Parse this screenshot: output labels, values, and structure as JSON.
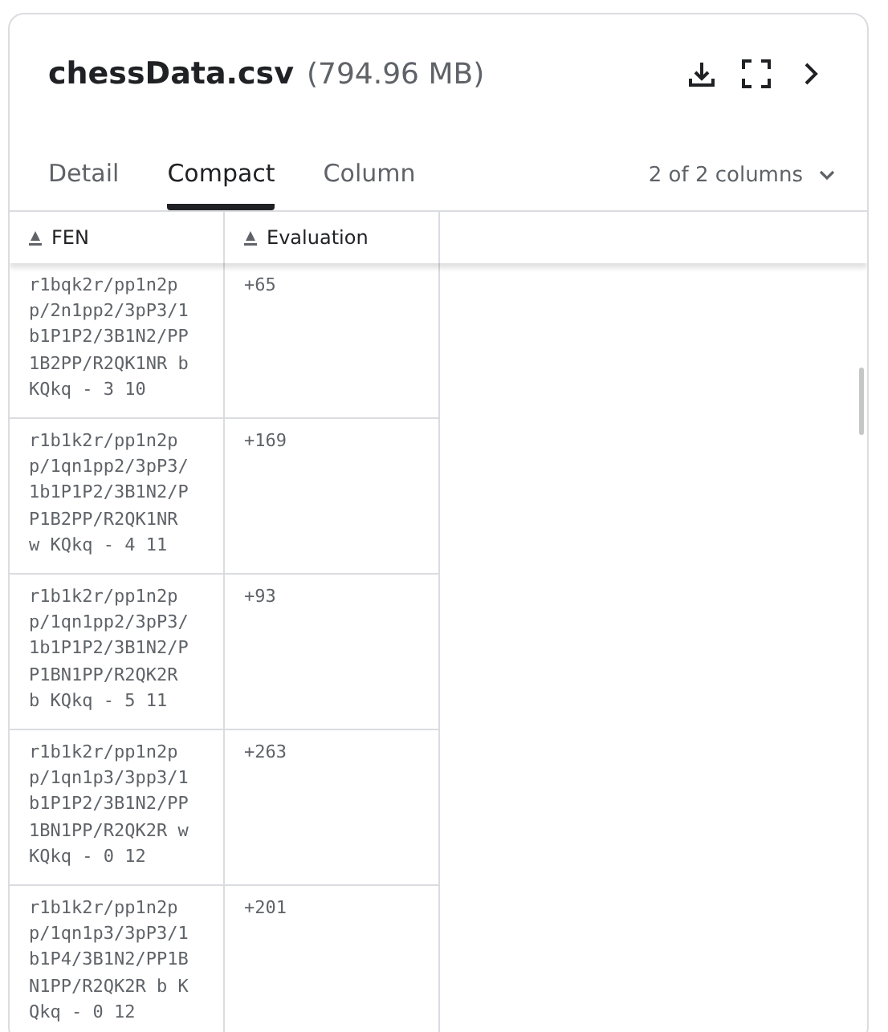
{
  "header": {
    "filename": "chessData.csv",
    "size": "(794.96 MB)"
  },
  "tabs": [
    {
      "label": "Detail",
      "selected": false
    },
    {
      "label": "Compact",
      "selected": true
    },
    {
      "label": "Column",
      "selected": false
    }
  ],
  "column_picker": "2 of 2 columns",
  "table": {
    "columns": [
      "FEN",
      "Evaluation"
    ],
    "rows": [
      [
        "r1bqk2r/pp1n2pp/2n1pp2/3pP3/1b1P1P2/3B1N2/PP1B2PP/R2QK1NR b KQkq - 3 10",
        "+65"
      ],
      [
        "r1b1k2r/pp1n2pp/1qn1pp2/3pP3/1b1P1P2/3B1N2/PP1B2PP/R2QK1NR w KQkq - 4 11",
        "+169"
      ],
      [
        "r1b1k2r/pp1n2pp/1qn1pp2/3pP3/1b1P1P2/3B1N2/PP1BN1PP/R2QK2R b KQkq - 5 11",
        "+93"
      ],
      [
        "r1b1k2r/pp1n2pp/1qn1p3/3pp3/1b1P1P2/3B1N2/PP1BN1PP/R2QK2R w KQkq - 0 12",
        "+263"
      ],
      [
        "r1b1k2r/pp1n2pp/1qn1p3/3pP3/1b1P4/3B1N2/PP1BN1PP/R2QK2R b KQkq - 0 12",
        "+201"
      ]
    ]
  }
}
